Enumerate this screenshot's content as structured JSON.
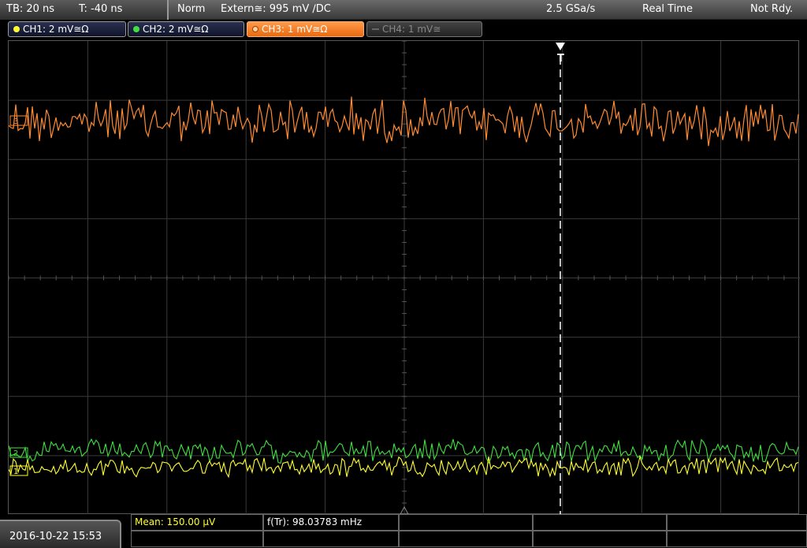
{
  "topbar": {
    "timebase": "TB: 20 ns",
    "trigger_time": "T: -40 ns",
    "mode": "Norm",
    "trigger_source": "Extern≅: 995 mV ∕DC",
    "sample_rate": "2.5 GSa/s",
    "acquisition": "Real Time",
    "status": "Not Rdy."
  },
  "channels": [
    {
      "label": "CH1: 2 mV≅Ω",
      "color": "#ffff30",
      "state": "on"
    },
    {
      "label": "CH2: 2 mV≅Ω",
      "color": "#40e040",
      "state": "on"
    },
    {
      "label": "CH3: 1 mV≅Ω",
      "color": "#ff8a30",
      "state": "active"
    },
    {
      "label": "CH4: 1 mV≅",
      "color": "#888888",
      "state": "off"
    }
  ],
  "display": {
    "trigger_marker_label": "T",
    "ch3_marker_label": "3",
    "ch2_marker_label": "2",
    "ch1_marker_label": "1"
  },
  "bottom": {
    "datetime": "2016-10-22 15:53",
    "mean": "Mean: 150.00 µV",
    "frequency": "f(Tr): 98.03783 mHz"
  },
  "colors": {
    "ch1": "#ffff30",
    "ch2": "#40e040",
    "ch3": "#ff8a30",
    "grid": "#3a3a3a",
    "trigger_line": "#ffffff"
  }
}
